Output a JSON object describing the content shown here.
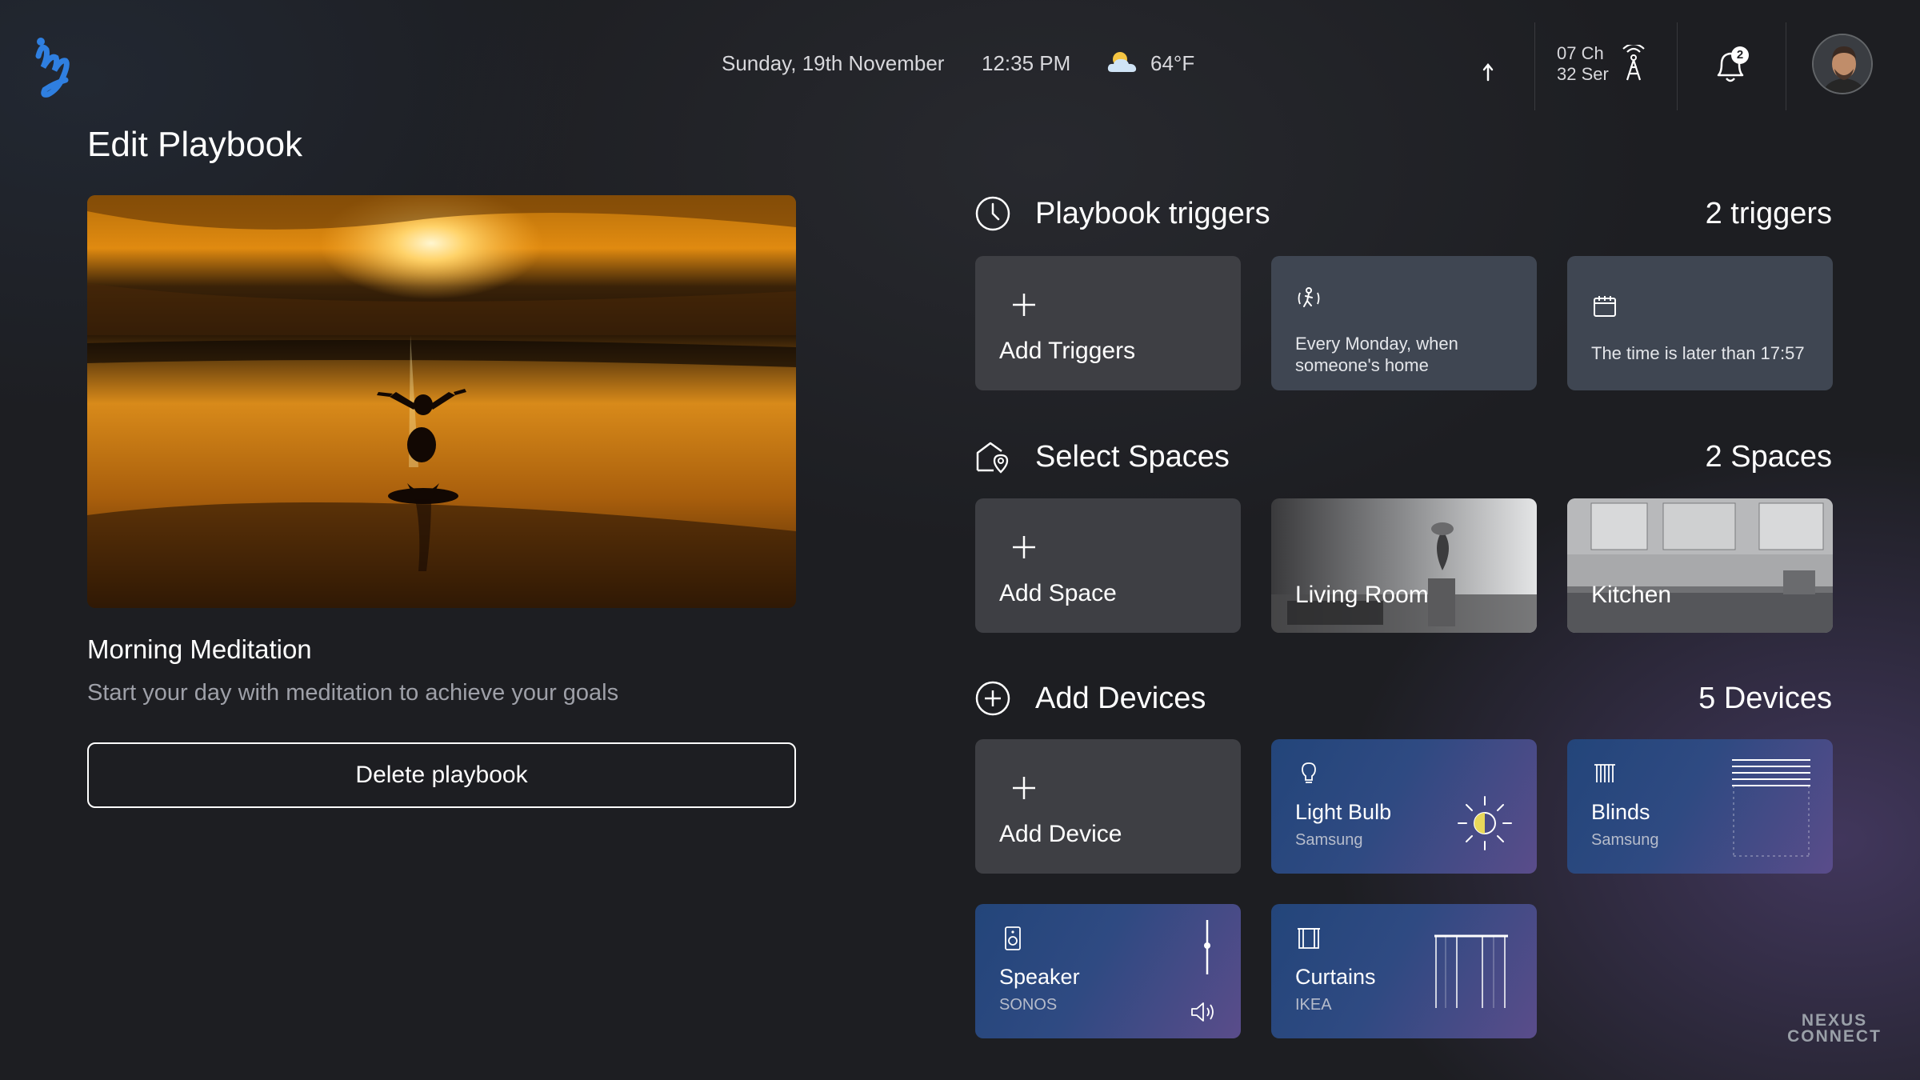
{
  "header": {
    "date": "Sunday, 19th November",
    "time": "12:35 PM",
    "temperature": "64°F",
    "channels": "07 Ch",
    "sensors": "32 Ser",
    "notification_count": "2"
  },
  "left": {
    "page_title": "Edit Playbook",
    "playbook_name": "Morning Meditation",
    "playbook_description": "Start your day with meditation to achieve your goals",
    "delete_label": "Delete playbook"
  },
  "triggers": {
    "title": "Playbook triggers",
    "count": "2 triggers",
    "add_label": "Add Triggers",
    "items": [
      {
        "text": "Every Monday, when someone's home",
        "icon": "motion-person-icon"
      },
      {
        "text": "The time is later than 17:57",
        "icon": "calendar-icon"
      }
    ]
  },
  "spaces": {
    "title": "Select Spaces",
    "count": "2 Spaces",
    "add_label": "Add Space",
    "items": [
      {
        "label": "Living Room"
      },
      {
        "label": "Kitchen"
      }
    ]
  },
  "devices": {
    "title": "Add Devices",
    "count": "5 Devices",
    "add_label": "Add Device",
    "items": [
      {
        "label": "Light Bulb",
        "brand": "Samsung",
        "icon": "lightbulb-icon"
      },
      {
        "label": "Blinds",
        "brand": "Samsung",
        "icon": "blinds-icon"
      },
      {
        "label": "Speaker",
        "brand": "SONOS",
        "icon": "speaker-icon"
      },
      {
        "label": "Curtains",
        "brand": "IKEA",
        "icon": "curtains-icon"
      }
    ]
  },
  "watermark": {
    "line1": "NEXUS",
    "line2": "CONNECT"
  },
  "colors": {
    "background": "#1d1e22",
    "card_add": "#3e3f44",
    "card_trigger": "#3f4652",
    "device_gradient_start": "#23457a",
    "device_gradient_end": "#5a4c8a",
    "logo_blue": "#2f7fe0"
  }
}
